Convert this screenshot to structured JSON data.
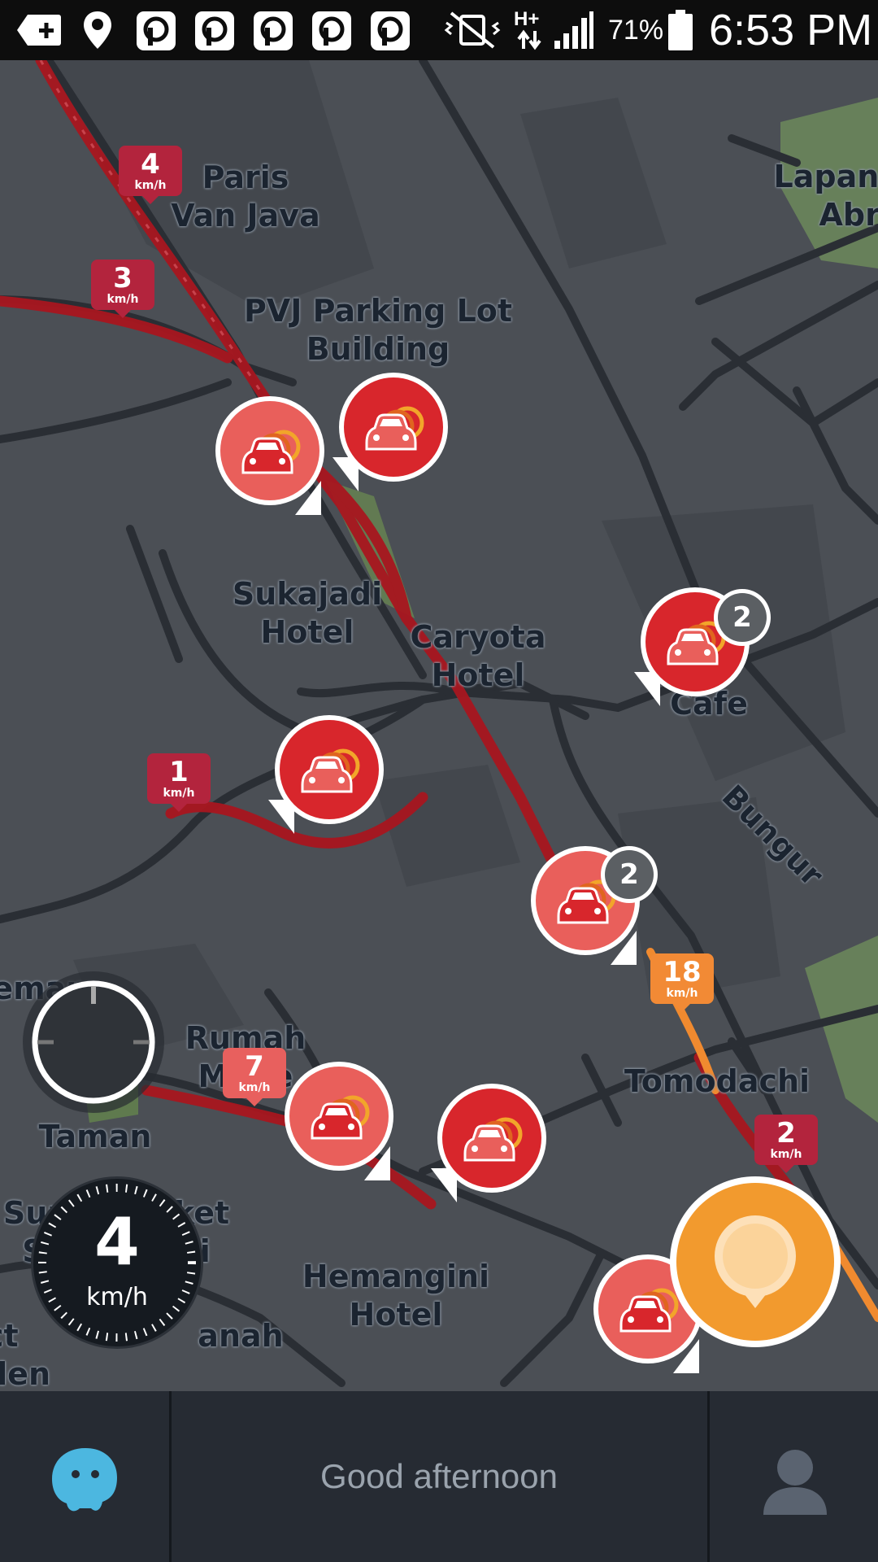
{
  "status_bar": {
    "battery": "71%",
    "time": "6:53 PM",
    "network": "H+",
    "icons": [
      "add-icon",
      "location-pin-icon",
      "p-app-icon",
      "p-app-icon",
      "p-app-icon",
      "p-app-icon",
      "p-app-icon",
      "vibrate-mute-icon",
      "data-arrows-icon",
      "signal-icon",
      "battery-icon"
    ]
  },
  "map": {
    "places": [
      {
        "id": "paris-van-java",
        "text": "Paris\nVan Java"
      },
      {
        "id": "pvj-parking",
        "text": "PVJ Parking Lot\nBuilding"
      },
      {
        "id": "lapangan",
        "text": "Lapang\nAbra"
      },
      {
        "id": "sukajadi-hotel",
        "text": "Sukajadi\nHotel"
      },
      {
        "id": "caryota-hotel",
        "text": "Caryota\nHotel"
      },
      {
        "id": "cafe",
        "text": "Cafe"
      },
      {
        "id": "bungur",
        "text": "Bungur"
      },
      {
        "id": "emara",
        "text": "emara"
      },
      {
        "id": "rumah-mode",
        "text": "Rumah\nMode"
      },
      {
        "id": "tomodachi",
        "text": "Tomodachi"
      },
      {
        "id": "taman",
        "text": "Taman"
      },
      {
        "id": "supermarket",
        "text": "Supermarket\nSetiabudhi"
      },
      {
        "id": "hemangini",
        "text": "Hemangini\nHotel"
      },
      {
        "id": "anah",
        "text": "anah"
      },
      {
        "id": "ct-den",
        "text": "ct\nden"
      },
      {
        "id": "setiabudi",
        "text": "Setiabudi"
      },
      {
        "id": "su",
        "text": "Su"
      }
    ],
    "speed_tags": [
      {
        "value": "4",
        "unit": "km/h",
        "color": "#b3243d"
      },
      {
        "value": "3",
        "unit": "km/h",
        "color": "#b3243d"
      },
      {
        "value": "1",
        "unit": "km/h",
        "color": "#b3243d"
      },
      {
        "value": "7",
        "unit": "km/h",
        "color": "#e8605e"
      },
      {
        "value": "18",
        "unit": "km/h",
        "color": "#f28a35"
      },
      {
        "value": "2",
        "unit": "km/h",
        "color": "#b3243d"
      }
    ],
    "jam_counts": [
      "2",
      "2"
    ],
    "speedometer": {
      "value": "4",
      "unit": "km/h"
    }
  },
  "bottom_bar": {
    "greeting": "Good afternoon",
    "left_icon": "wazer-icon",
    "right_icon": "profile-icon"
  },
  "colors": {
    "jam_dark": "#d8262c",
    "jam_light": "#e95f5b",
    "route_red": "#a8161f",
    "report_orange": "#f29a2e"
  }
}
